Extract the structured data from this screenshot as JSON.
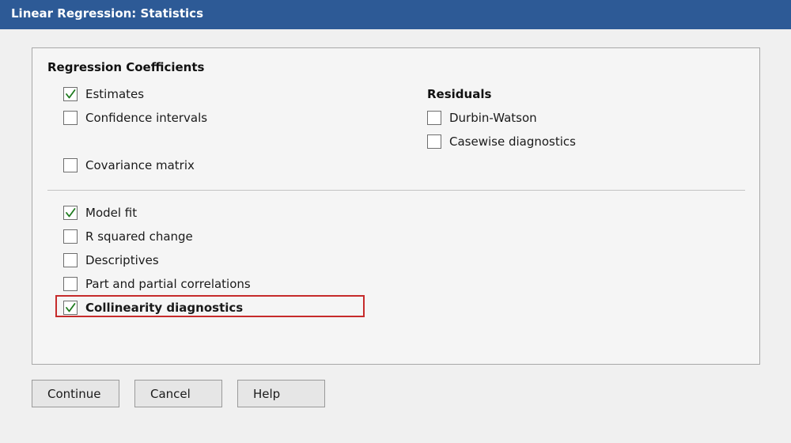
{
  "window": {
    "title": "Linear Regression: Statistics",
    "title_bg": "#2d5a96"
  },
  "regression_coefficients": {
    "title": "Regression Coefficients",
    "items": [
      {
        "label": "Estimates",
        "checked": true
      },
      {
        "label": "Confidence intervals",
        "checked": false
      },
      {
        "label": "Covariance matrix",
        "checked": false
      }
    ]
  },
  "residuals": {
    "title": "Residuals",
    "items": [
      {
        "label": "Durbin-Watson",
        "checked": false
      },
      {
        "label": "Casewise diagnostics",
        "checked": false
      }
    ]
  },
  "other_options": {
    "items": [
      {
        "label": "Model fit",
        "checked": true
      },
      {
        "label": "R squared change",
        "checked": false
      },
      {
        "label": "Descriptives",
        "checked": false
      },
      {
        "label": "Part and partial correlations",
        "checked": false
      },
      {
        "label": "Collinearity diagnostics",
        "checked": true,
        "highlighted": true
      }
    ]
  },
  "buttons": {
    "continue": "Continue",
    "cancel": "Cancel",
    "help": "Help"
  },
  "colors": {
    "check_mark": "#1e7a1e",
    "highlight_border": "#c62b2b"
  },
  "icons": {
    "checked": "check-mark-icon"
  }
}
